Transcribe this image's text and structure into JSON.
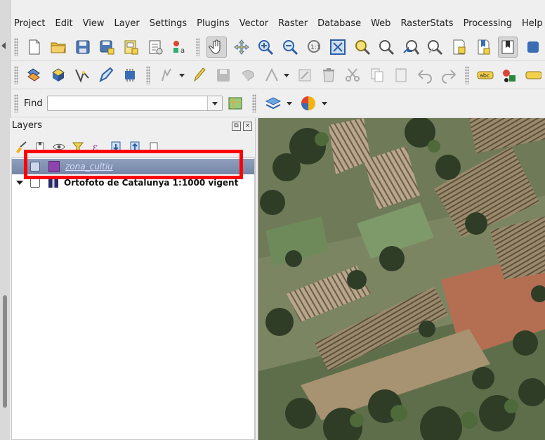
{
  "menu": [
    "Project",
    "Edit",
    "View",
    "Layer",
    "Settings",
    "Plugins",
    "Vector",
    "Raster",
    "Database",
    "Web",
    "RasterStats",
    "Processing",
    "Help"
  ],
  "find": {
    "label": "Find",
    "value": ""
  },
  "toolbar1": [
    "new-project-icon",
    "open-project-icon",
    "save-project-icon",
    "save-as-icon",
    "print-layout-icon",
    "layout-manager-icon",
    "style-manager-icon",
    "pan-hand-icon",
    "pan-to-selection-icon",
    "zoom-in-icon",
    "zoom-out-icon",
    "zoom-native-icon",
    "zoom-full-icon",
    "zoom-to-selection-icon",
    "zoom-to-layer-icon",
    "zoom-last-icon",
    "zoom-next-icon",
    "new-bookmark-icon",
    "show-bookmarks-icon",
    "temporal-icon",
    "refresh-icon"
  ],
  "toolbar2": [
    "add-layer-icon",
    "add-spatialite-icon",
    "digitize-icon",
    "edit-pen-icon",
    "toggle-editing-icon",
    "vertex-tool-icon",
    "pencil-icon",
    "save-edits-icon",
    "add-feature-icon",
    "move-feature-icon",
    "node-tool-icon",
    "delete-selected-icon",
    "cut-features-icon",
    "copy-features-icon",
    "paste-features-icon",
    "undo-icon",
    "redo-icon",
    "label-abc-icon",
    "label-style-icon",
    "label-more-icon"
  ],
  "layers_panel": {
    "title": "Layers",
    "layers": [
      {
        "name": "zona_cultiu",
        "selected": true,
        "color": "#8e44ad"
      },
      {
        "name": "Ortofoto de Catalunya 1:1000 vigent",
        "selected": false
      }
    ]
  },
  "colors": {
    "highlight": "#ff0000",
    "selection": "#7f8fb0",
    "layer_fill": "#8e44ad"
  }
}
